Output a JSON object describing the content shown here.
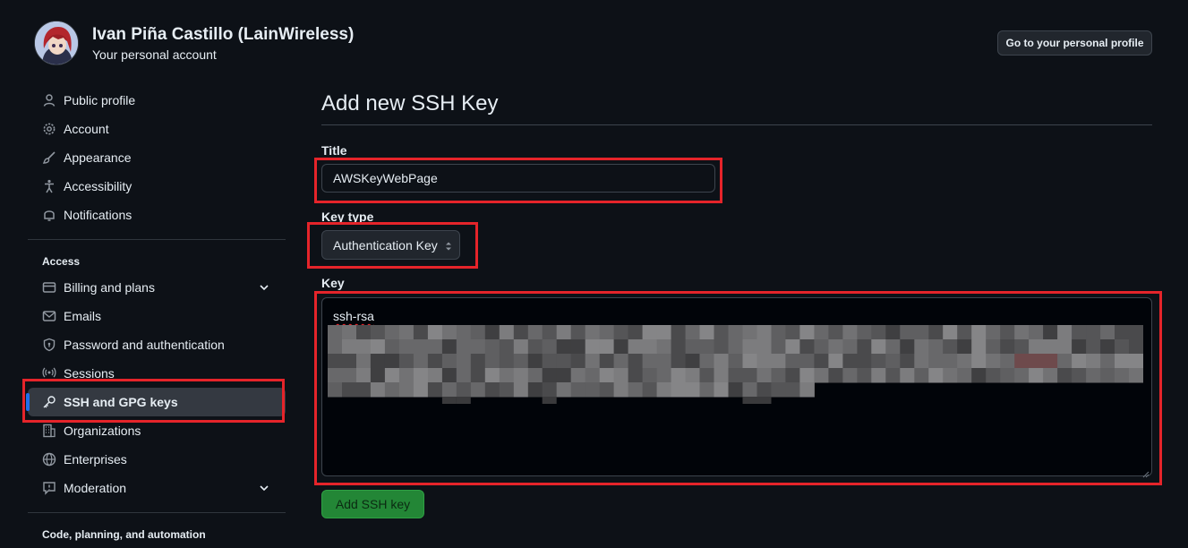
{
  "header": {
    "name": "Ivan Piña Castillo (LainWireless)",
    "subtitle": "Your personal account",
    "profile_button": "Go to your personal profile"
  },
  "sidebar": {
    "items": [
      {
        "label": "Public profile",
        "icon": "person-icon"
      },
      {
        "label": "Account",
        "icon": "gear-icon"
      },
      {
        "label": "Appearance",
        "icon": "paintbrush-icon"
      },
      {
        "label": "Accessibility",
        "icon": "accessibility-icon"
      },
      {
        "label": "Notifications",
        "icon": "bell-icon"
      }
    ],
    "access_heading": "Access",
    "access_items": [
      {
        "label": "Billing and plans",
        "icon": "credit-card-icon",
        "expandable": true
      },
      {
        "label": "Emails",
        "icon": "mail-icon"
      },
      {
        "label": "Password and authentication",
        "icon": "shield-lock-icon"
      },
      {
        "label": "Sessions",
        "icon": "broadcast-icon"
      },
      {
        "label": "SSH and GPG keys",
        "icon": "key-icon",
        "active": true
      },
      {
        "label": "Organizations",
        "icon": "organization-icon"
      },
      {
        "label": "Enterprises",
        "icon": "globe-icon"
      },
      {
        "label": "Moderation",
        "icon": "report-icon",
        "expandable": true
      }
    ],
    "code_heading": "Code, planning, and automation"
  },
  "main": {
    "title": "Add new SSH Key",
    "title_label": "Title",
    "title_value": "AWSKeyWebPage",
    "key_type_label": "Key type",
    "key_type_value": "Authentication Key",
    "key_label": "Key",
    "key_value_prefix": "ssh-rsa",
    "submit_label": "Add SSH key"
  },
  "colors": {
    "background": "#0d1117",
    "accent": "#1f6feb",
    "submit": "#238636",
    "highlight": "#e5242a"
  }
}
